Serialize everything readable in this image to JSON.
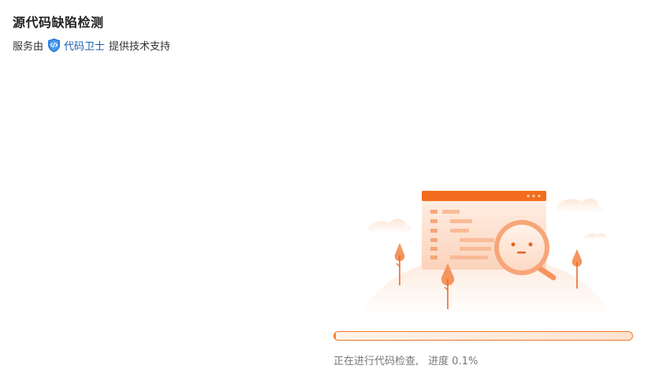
{
  "header": {
    "title": "源代码缺陷检测",
    "provider_prefix": "服务由",
    "provider_name": "代码卫士",
    "provider_suffix": "提供技术支持",
    "brand_icon": "shield-code-icon",
    "brand_color": "#1a5fb4"
  },
  "scan": {
    "illustration": "magnifier-scanning-code-illustration",
    "status_text": "正在进行代码检查,",
    "progress_label": "进度",
    "progress_value": "0.1%",
    "progress_fraction": 0.001,
    "accent_color": "#f07c2a"
  }
}
